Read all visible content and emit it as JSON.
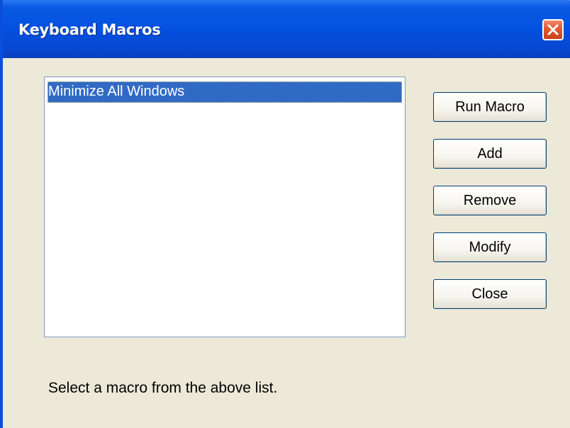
{
  "window": {
    "title": "Keyboard Macros"
  },
  "macro_list": {
    "items": [
      "Minimize All Windows"
    ],
    "selected_index": 0
  },
  "buttons": {
    "run_macro": "Run Macro",
    "add": "Add",
    "remove": "Remove",
    "modify": "Modify",
    "close": "Close"
  },
  "status": {
    "text": "Select a macro from the above list."
  },
  "colors": {
    "titlebar": "#0451df",
    "selection": "#316ac5",
    "close_button": "#e2592f",
    "dialog_background": "#ece9d8"
  },
  "icons": {
    "close": "close-icon"
  }
}
